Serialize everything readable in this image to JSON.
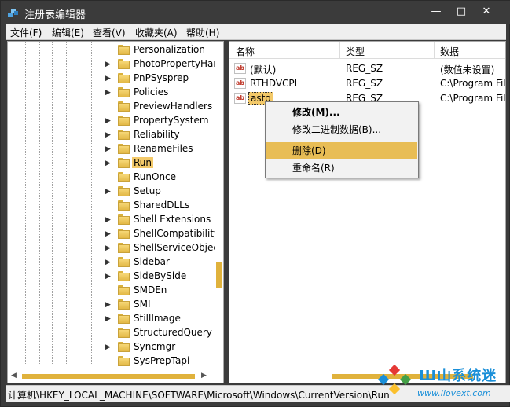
{
  "window": {
    "title": "注册表编辑器",
    "controls": {
      "minimize": "—",
      "maximize": "□",
      "close": "✕"
    }
  },
  "menubar": {
    "items": [
      {
        "label": "文件(F)"
      },
      {
        "label": "编辑(E)"
      },
      {
        "label": "查看(V)"
      },
      {
        "label": "收藏夹(A)"
      },
      {
        "label": "帮助(H)"
      }
    ]
  },
  "tree": {
    "items": [
      {
        "label": "Personalization",
        "expandable": false
      },
      {
        "label": "PhotoPropertyHan",
        "expandable": true
      },
      {
        "label": "PnPSysprep",
        "expandable": true
      },
      {
        "label": "Policies",
        "expandable": true
      },
      {
        "label": "PreviewHandlers",
        "expandable": false
      },
      {
        "label": "PropertySystem",
        "expandable": true
      },
      {
        "label": "Reliability",
        "expandable": true
      },
      {
        "label": "RenameFiles",
        "expandable": true
      },
      {
        "label": "Run",
        "expandable": true,
        "selected": true
      },
      {
        "label": "RunOnce",
        "expandable": false
      },
      {
        "label": "Setup",
        "expandable": true
      },
      {
        "label": "SharedDLLs",
        "expandable": false
      },
      {
        "label": "Shell Extensions",
        "expandable": true
      },
      {
        "label": "ShellCompatibility",
        "expandable": true
      },
      {
        "label": "ShellServiceObjectI",
        "expandable": true
      },
      {
        "label": "Sidebar",
        "expandable": true
      },
      {
        "label": "SideBySide",
        "expandable": true
      },
      {
        "label": "SMDEn",
        "expandable": false
      },
      {
        "label": "SMI",
        "expandable": true
      },
      {
        "label": "StillImage",
        "expandable": true
      },
      {
        "label": "StructuredQuery",
        "expandable": false
      },
      {
        "label": "Syncmgr",
        "expandable": true
      },
      {
        "label": "SysPrepTapi",
        "expandable": false
      }
    ]
  },
  "list": {
    "columns": {
      "name": "名称",
      "type": "类型",
      "data": "数据"
    },
    "rows": [
      {
        "name": "(默认)",
        "type": "REG_SZ",
        "data": "(数值未设置)",
        "icon": "ab"
      },
      {
        "name": "RTHDVCPL",
        "type": "REG_SZ",
        "data": "C:\\Program File",
        "icon": "ab"
      },
      {
        "name": "asto",
        "type": "REG_SZ",
        "data": "C:\\Program File",
        "icon": "ab",
        "selected": true
      }
    ]
  },
  "context_menu": {
    "items": [
      {
        "label": "修改(M)..."
      },
      {
        "label": "修改二进制数据(B)..."
      },
      {
        "label": "删除(D)"
      },
      {
        "label": "重命名(R)"
      }
    ]
  },
  "statusbar": {
    "path": "计算机\\HKEY_LOCAL_MACHINE\\SOFTWARE\\Microsoft\\Windows\\CurrentVersion\\Run"
  },
  "watermark": {
    "brand": "Ш山系统迷",
    "url": "www.ilovext.com"
  },
  "colors": {
    "accent": "#f3c969",
    "titlebar": "#3b3b3b",
    "scroll_thumb": "#e0b23c"
  }
}
